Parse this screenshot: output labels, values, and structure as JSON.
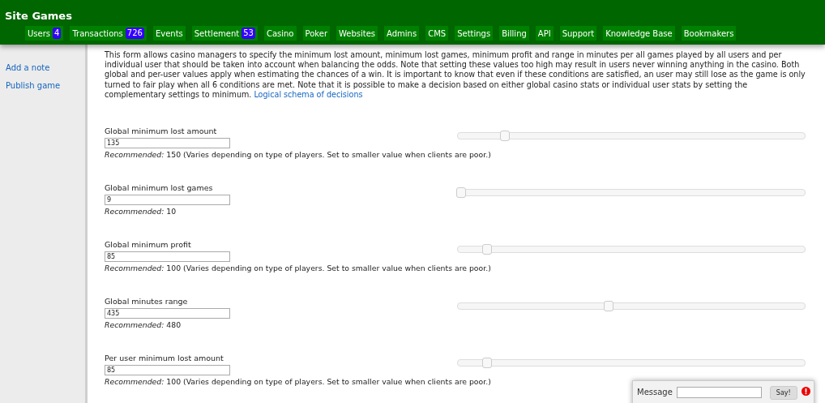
{
  "header": {
    "title": "Site Games"
  },
  "nav": [
    {
      "label": "Users",
      "badge": "4"
    },
    {
      "label": "Transactions",
      "badge": "726"
    },
    {
      "label": "Events"
    },
    {
      "label": "Settlement",
      "badge": "53"
    },
    {
      "label": "Casino"
    },
    {
      "label": "Poker"
    },
    {
      "label": "Websites"
    },
    {
      "label": "Admins"
    },
    {
      "label": "CMS"
    },
    {
      "label": "Settings"
    },
    {
      "label": "Billing"
    },
    {
      "label": "API"
    },
    {
      "label": "Support"
    },
    {
      "label": "Knowledge Base"
    },
    {
      "label": "Bookmakers"
    }
  ],
  "sidebar": {
    "links": [
      "Add a note",
      "Publish game"
    ]
  },
  "intro": {
    "text": "This form allows casino managers to specify the minimum lost amount, minimum lost games, minimum profit and range in minutes per all games played by all users and per individual user that should be taken into account when balancing the odds. Note that setting these values too high may result in users never winning anything in the casino. Both global and per-user values apply when estimating the chances of a win. It is important to know that even if these conditions are satisfied, an user may still lose as the game is only turned to fair play when all 6 conditions are met. Note that it is possible to make a decision based on either global casino stats or individual user stats by setting the complementary settings to minimum.",
    "link": "Logical schema of decisions"
  },
  "fields": [
    {
      "label": "Global minimum lost amount",
      "value": "135",
      "level": 0.135,
      "hint": "*Recommended:* 150 (Varies depending on type of players. Set to smaller value when clients are poor.)"
    },
    {
      "label": "Global minimum lost games",
      "value": "9",
      "level": 0.009,
      "hint": "*Recommended:* 10"
    },
    {
      "label": "Global minimum profit",
      "value": "85",
      "level": 0.085,
      "hint": "*Recommended:* 100 (Varies depending on type of players. Set to smaller value when clients are poor.)"
    },
    {
      "label": "Global minutes range",
      "value": "435",
      "level": 0.435,
      "hint": "*Recommended:* 480"
    },
    {
      "label": "Per user minimum lost amount",
      "value": "85",
      "level": 0.085,
      "hint": "*Recommended:* 100 (Varies depending on type of players. Set to smaller value when clients are poor.)"
    }
  ],
  "chat": {
    "label": "Message",
    "button": "Say!"
  }
}
